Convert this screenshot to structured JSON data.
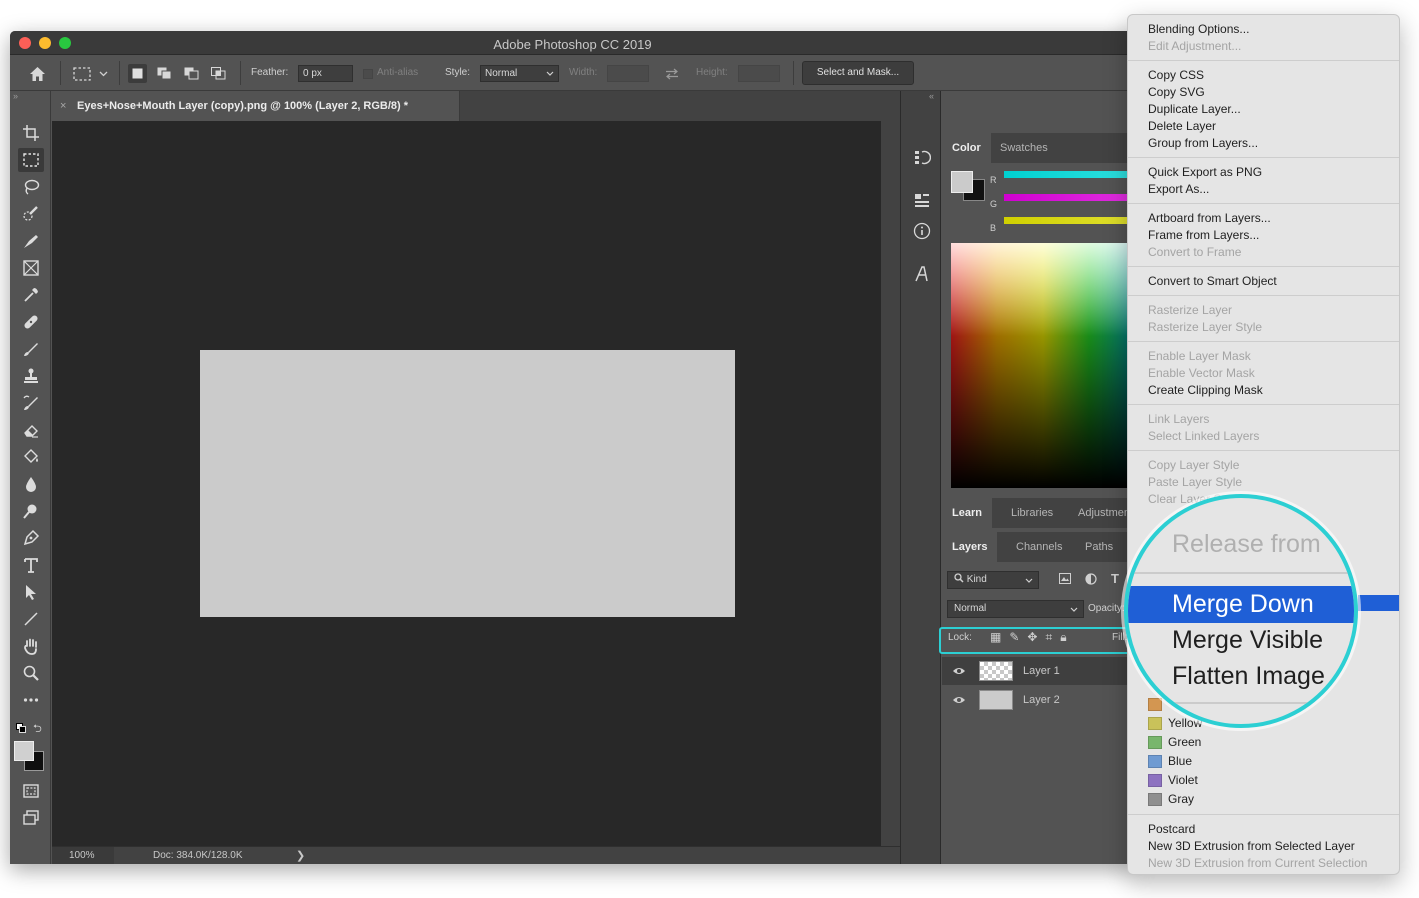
{
  "window": {
    "title": "Adobe Photoshop CC 2019"
  },
  "options_bar": {
    "feather_label": "Feather:",
    "feather_value": "0 px",
    "anti_alias_label": "Anti-alias",
    "style_label": "Style:",
    "style_value": "Normal",
    "width_label": "Width:",
    "height_label": "Height:",
    "select_and_mask_label": "Select and Mask..."
  },
  "document": {
    "tab_title": "Eyes+Nose+Mouth Layer (copy).png @ 100% (Layer 2, RGB/8) *",
    "close_glyph": "×"
  },
  "status_bar": {
    "zoom": "100%",
    "doc_info": "Doc: 384.0K/128.0K",
    "arrow": "❯"
  },
  "panels": {
    "top_tabs": [
      "Color",
      "Swatches"
    ],
    "color_sliders": [
      "R",
      "G",
      "B"
    ],
    "mid_tabs": [
      "Learn",
      "Libraries",
      "Adjustments"
    ],
    "layer_tabs": [
      "Layers",
      "Channels",
      "Paths"
    ],
    "kind_filter": "Kind",
    "blend_mode": "Normal",
    "opacity_label": "Opacity:",
    "lock_label": "Lock:",
    "fill_label": "Fill:",
    "layers": [
      {
        "name": "Layer 1",
        "thumb": "transparent",
        "selected": true
      },
      {
        "name": "Layer 2",
        "thumb": "gray",
        "selected": false
      }
    ]
  },
  "context_menu": {
    "groups": [
      [
        {
          "label": "Blending Options...",
          "enabled": true
        },
        {
          "label": "Edit Adjustment...",
          "enabled": false
        }
      ],
      [
        {
          "label": "Copy CSS",
          "enabled": true
        },
        {
          "label": "Copy SVG",
          "enabled": true
        },
        {
          "label": "Duplicate Layer...",
          "enabled": true
        },
        {
          "label": "Delete Layer",
          "enabled": true
        },
        {
          "label": "Group from Layers...",
          "enabled": true
        }
      ],
      [
        {
          "label": "Quick Export as PNG",
          "enabled": true
        },
        {
          "label": "Export As...",
          "enabled": true
        }
      ],
      [
        {
          "label": "Artboard from Layers...",
          "enabled": true
        },
        {
          "label": "Frame from Layers...",
          "enabled": true
        },
        {
          "label": "Convert to Frame",
          "enabled": false
        }
      ],
      [
        {
          "label": "Convert to Smart Object",
          "enabled": true
        }
      ],
      [
        {
          "label": "Rasterize Layer",
          "enabled": false
        },
        {
          "label": "Rasterize Layer Style",
          "enabled": false
        }
      ],
      [
        {
          "label": "Enable Layer Mask",
          "enabled": false
        },
        {
          "label": "Enable Vector Mask",
          "enabled": false
        },
        {
          "label": "Create Clipping Mask",
          "enabled": true
        }
      ],
      [
        {
          "label": "Link Layers",
          "enabled": false
        },
        {
          "label": "Select Linked Layers",
          "enabled": false
        }
      ],
      [
        {
          "label": "Copy Layer Style",
          "enabled": false
        },
        {
          "label": "Paste Layer Style",
          "enabled": false
        },
        {
          "label": "Clear Layer Style",
          "enabled": false
        }
      ]
    ],
    "colors": [
      {
        "label": "Yellow",
        "color": "#c9c25a"
      },
      {
        "label": "Green",
        "color": "#78b66c"
      },
      {
        "label": "Blue",
        "color": "#6f9bd2"
      },
      {
        "label": "Violet",
        "color": "#8d72c0"
      },
      {
        "label": "Gray",
        "color": "#8f8f8f"
      }
    ],
    "footer": [
      {
        "label": "Postcard",
        "enabled": true
      },
      {
        "label": "New 3D Extrusion from Selected Layer",
        "enabled": true
      },
      {
        "label": "New 3D Extrusion from Current Selection",
        "enabled": false
      }
    ],
    "highlighted": "Merge Down"
  },
  "magnifier": {
    "items": [
      {
        "label": "Release from",
        "enabled": false
      },
      {
        "label": "Merge Down",
        "enabled": true,
        "highlighted": true
      },
      {
        "label": "Merge Visible",
        "enabled": true
      },
      {
        "label": "Flatten Image",
        "enabled": true
      }
    ]
  },
  "colors": {
    "accent": "#2ccfd3",
    "menu_highlight": "#1f5fd6",
    "canvas_bg": "#282828",
    "document_fill": "#cbcbcb"
  }
}
